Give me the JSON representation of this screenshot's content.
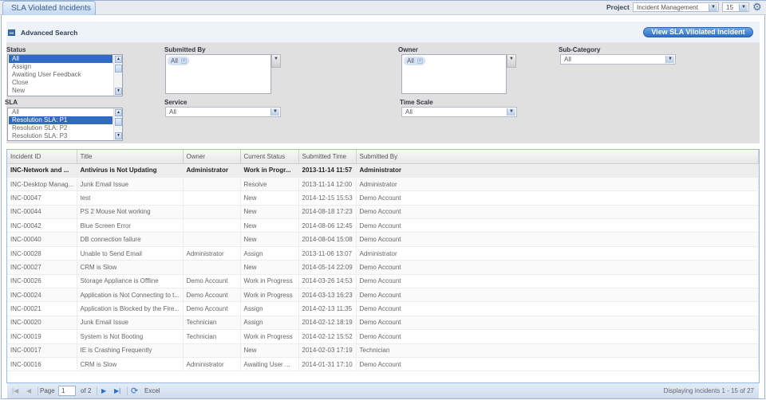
{
  "tab": {
    "title": "SLA Violated Incidents"
  },
  "toolbar": {
    "project_label": "Project",
    "project_value": "Incident Management",
    "page_size": "15"
  },
  "search": {
    "title": "Advanced Search",
    "view_button": "View SLA Vilolated Incident",
    "status": {
      "label": "Status",
      "options": [
        "All",
        "Assign",
        "Awaiting User Feedback",
        "Close",
        "New"
      ],
      "selected": "All"
    },
    "sla": {
      "label": "SLA",
      "options": [
        "All",
        "Resolution SLA: P1",
        "Resolution SLA: P2",
        "Resolution SLA: P3"
      ],
      "selected": "Resolution SLA: P1"
    },
    "submitted_by": {
      "label": "Submitted By",
      "chip": "All"
    },
    "service": {
      "label": "Service",
      "value": "All"
    },
    "owner": {
      "label": "Owner",
      "chip": "All"
    },
    "time_scale": {
      "label": "Time Scale",
      "value": "All"
    },
    "sub_category": {
      "label": "Sub-Category",
      "value": "All"
    }
  },
  "grid": {
    "columns": [
      "Incident ID",
      "Title",
      "Owner",
      "Current Status",
      "Submitted Time",
      "Submitted By"
    ],
    "rows": [
      [
        "INC-Network and ...",
        "Antivirus is Not Updating",
        "Administrator",
        "Work in Progr...",
        "2013-11-14 11:57",
        "Administrator"
      ],
      [
        "INC-Desktop Manag...",
        "Junk Email Issue",
        "",
        "Resolve",
        "2013-11-14 12:00",
        "Administrator"
      ],
      [
        "INC-00047",
        "test",
        "",
        "New",
        "2014-12-15 15:53",
        "Demo Account"
      ],
      [
        "INC-00044",
        "PS 2 Mouse Not working",
        "",
        "New",
        "2014-08-18 17:23",
        "Demo Account"
      ],
      [
        "INC-00042",
        "Blue Screen Error",
        "",
        "New",
        "2014-08-06 12:45",
        "Demo Account"
      ],
      [
        "INC-00040",
        "DB connection failure",
        "",
        "New",
        "2014-08-04 15:08",
        "Demo Account"
      ],
      [
        "INC-00028",
        "Unable to Send Email",
        "Administrator",
        "Assign",
        "2013-11-06 13:07",
        "Administrator"
      ],
      [
        "INC-00027",
        "CRM is Slow",
        "",
        "New",
        "2014-05-14 22:09",
        "Demo Account"
      ],
      [
        "INC-00026",
        "Storage Appliance is Offline",
        "Demo Account",
        "Work in Progress",
        "2014-03-26 14:53",
        "Demo Account"
      ],
      [
        "INC-00024",
        "Application is Not Connecting to t...",
        "Demo Account",
        "Work in Progress",
        "2014-03-13 16:23",
        "Demo Account"
      ],
      [
        "INC-00021",
        "Application is Blocked by the Fire...",
        "Demo Account",
        "Assign",
        "2014-02-13 11:35",
        "Demo Account"
      ],
      [
        "INC-00020",
        "Junk Email Issue",
        "Technician",
        "Assign",
        "2014-02-12 18:19",
        "Demo Account"
      ],
      [
        "INC-00019",
        "System is Not Booting",
        "Technician",
        "Work in Progress",
        "2014-02-12 15:52",
        "Demo Account"
      ],
      [
        "INC-00017",
        "IE is Crashing Frequently",
        "",
        "New",
        "2014-02-03 17:19",
        "Technician"
      ],
      [
        "INC-00016",
        "CRM is Slow",
        "Administrator",
        "Awaiting User ...",
        "2014-01-31 17:10",
        "Demo Account"
      ]
    ]
  },
  "pager": {
    "page_label": "Page",
    "page": "1",
    "of_label": "of 2",
    "excel": "Excel",
    "display": "Displaying incidents 1 - 15 of 27"
  }
}
